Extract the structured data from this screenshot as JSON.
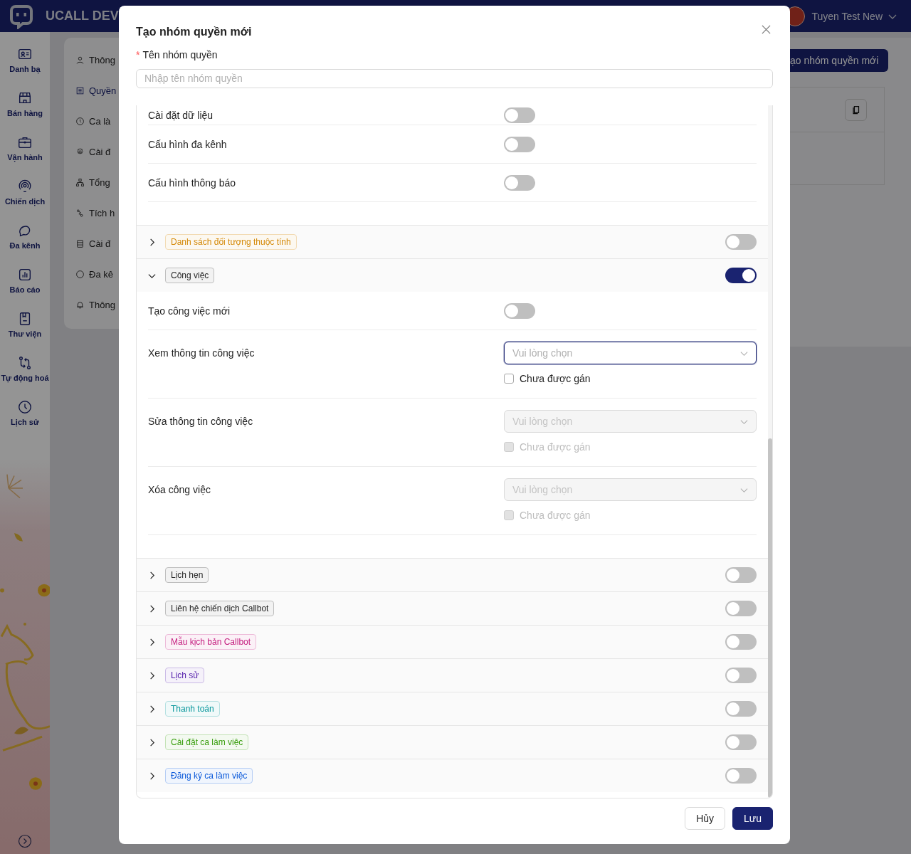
{
  "app": {
    "brand": "UCALL DEV",
    "user": "Tuyen Test New",
    "nav": [
      {
        "label": "Danh bạ"
      },
      {
        "label": "Bán hàng"
      },
      {
        "label": "Vận hành"
      },
      {
        "label": "Chiến dịch"
      },
      {
        "label": "Đa kênh"
      },
      {
        "label": "Báo cáo"
      },
      {
        "label": "Thư viện"
      },
      {
        "label": "Tự động hoá"
      },
      {
        "label": "Lịch sử"
      }
    ],
    "submenu": [
      {
        "label": "Thông",
        "selected": false
      },
      {
        "label": "Quyền",
        "selected": true
      },
      {
        "label": "Ca là",
        "selected": false
      },
      {
        "label": "Cài đ",
        "selected": false
      },
      {
        "label": "Tổng",
        "selected": false
      },
      {
        "label": "Tích h",
        "selected": false
      },
      {
        "label": "Cài đ",
        "selected": false
      },
      {
        "label": "Đa kê",
        "selected": false
      },
      {
        "label": "Thông",
        "selected": false
      }
    ],
    "create_button": "ạo nhóm quyền mới"
  },
  "modal": {
    "title": "Tạo nhóm quyền mới",
    "name_field": {
      "label": "Tên nhóm quyền",
      "required_mark": "*",
      "placeholder": "Nhập tên nhóm quyền"
    },
    "earlier_rows": [
      {
        "kind": "toggle",
        "label": "Cài đặt dữ liệu",
        "on": false
      },
      {
        "kind": "toggle",
        "label": "Cấu hình đa kênh",
        "on": false
      },
      {
        "kind": "toggle",
        "label": "Cấu hình thông báo",
        "on": false
      }
    ],
    "groups": [
      {
        "tag": "Danh sách đối tượng thuộc tính",
        "color": "#d48806",
        "expanded": false,
        "on": false
      },
      {
        "tag": "Công việc",
        "color": "#262626",
        "expanded": true,
        "on": true,
        "rows": [
          {
            "kind": "toggle",
            "label": "Tạo công việc mới",
            "on": false
          },
          {
            "kind": "select",
            "label": "Xem thông tin công việc",
            "placeholder": "Vui lòng chọn",
            "disabled": false,
            "focused": true,
            "checkbox": {
              "label": "Chưa được gán",
              "checked": false,
              "disabled": false
            }
          },
          {
            "kind": "select",
            "label": "Sửa thông tin công việc",
            "placeholder": "Vui lòng chọn",
            "disabled": true,
            "focused": false,
            "checkbox": {
              "label": "Chưa được gán",
              "checked": false,
              "disabled": true
            }
          },
          {
            "kind": "select",
            "label": "Xóa công việc",
            "placeholder": "Vui lòng chọn",
            "disabled": true,
            "focused": false,
            "checkbox": {
              "label": "Chưa được gán",
              "checked": false,
              "disabled": true
            }
          }
        ]
      },
      {
        "tag": "Lịch hẹn",
        "color": "#262626",
        "expanded": false,
        "on": false
      },
      {
        "tag": "Liên hệ chiến dịch Callbot",
        "color": "#262626",
        "expanded": false,
        "on": false
      },
      {
        "tag": "Mẫu kịch bản Callbot",
        "color": "#c41d7f",
        "expanded": false,
        "on": false
      },
      {
        "tag": "Lịch sử",
        "color": "#531dab",
        "expanded": false,
        "on": false
      },
      {
        "tag": "Thanh toán",
        "color": "#08979c",
        "expanded": false,
        "on": false
      },
      {
        "tag": "Cài đặt ca làm việc",
        "color": "#389e0d",
        "expanded": false,
        "on": false
      },
      {
        "tag": "Đăng ký ca làm việc",
        "color": "#0958d9",
        "expanded": false,
        "on": false
      }
    ],
    "buttons": {
      "cancel": "Hủy",
      "save": "Lưu"
    }
  }
}
